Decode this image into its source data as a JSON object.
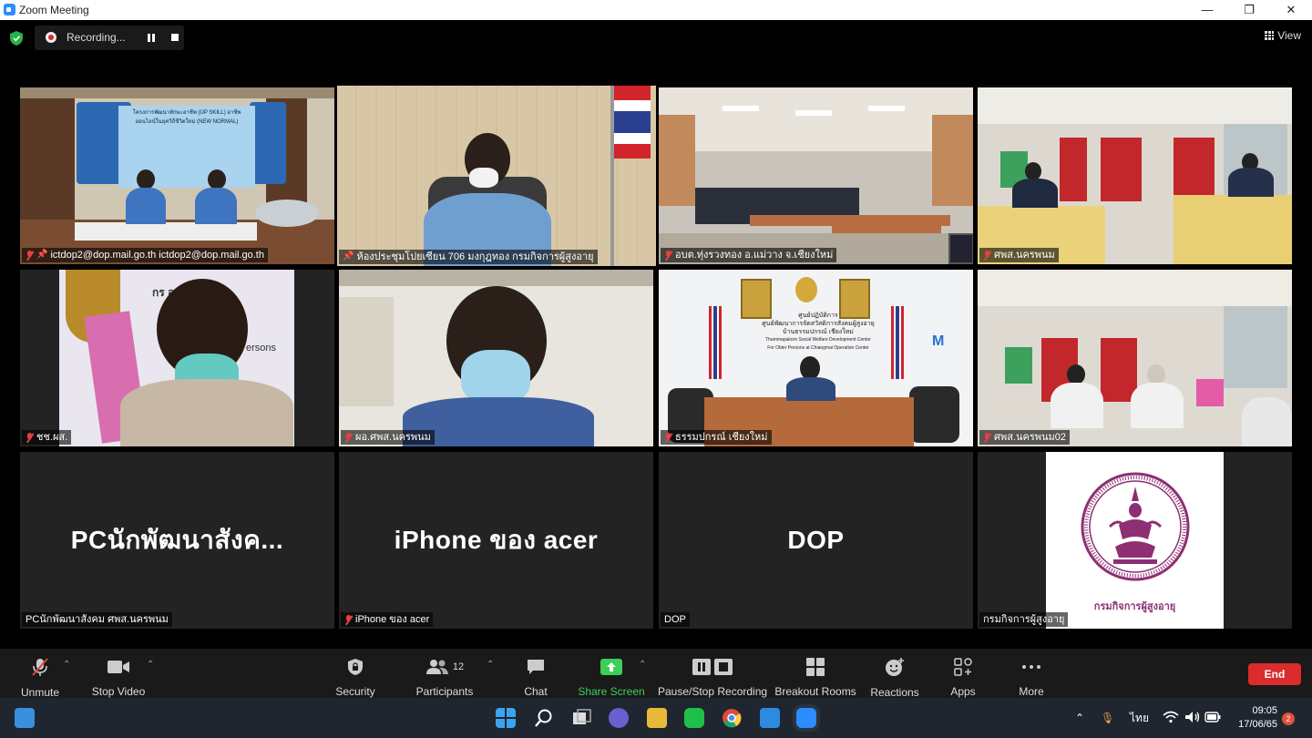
{
  "window": {
    "title": "Zoom Meeting",
    "minimize": "—",
    "maximize": "❐",
    "close": "✕"
  },
  "recording": {
    "label": "Recording..."
  },
  "view": {
    "label": "View"
  },
  "tiles": [
    {
      "name": "ictdop2@dop.mail.go.th ictdop2@dop.mail.go.th",
      "banner": "โครงการพัฒนาทักษะอาชีพ (UP SKILL) อาชีพ",
      "banner2": "ออนไลน์ในยุควิถีชีวิตใหม่ (NEW NORMAL)"
    },
    {
      "name": "ห้องประชุมโปยเซียน 706 มงกุฎทอง กรมกิจการผู้สูงอายุ"
    },
    {
      "name": "อบต.ทุ่งรวงทอง อ.แม่วาง จ.เชียงใหม่"
    },
    {
      "name": "ศพส.นครพนม"
    },
    {
      "name": "ชช.ผส.",
      "banner": "กร        อายุ",
      "banner2": "ersons"
    },
    {
      "name": "ผอ.ศพส.นครพนม"
    },
    {
      "name": "ธรรมปกรณ์ เชียงใหม่",
      "sign1": "ศูนย์ปฏิบัติการ",
      "sign2": "ศูนย์พัฒนาการจัดสวัสดิการสังคมผู้สูงอายุ",
      "sign3": "บ้านธรรมปกรณ์ เชียงใหม่",
      "sign4": "Thammapakorn Social Welfare Development Center",
      "sign5": "For Older Persons at Chiangmai Operation Center"
    },
    {
      "name": "ศพส.นครพนม02"
    },
    {
      "name": "PCนักพัฒนาสังคม ศพส.นครพนม",
      "display": "PCนักพัฒนาสังค..."
    },
    {
      "name": "iPhone ของ acer",
      "display": "iPhone ของ acer"
    },
    {
      "name": "DOP",
      "display": "DOP"
    },
    {
      "name": "กรมกิจการผู้สูงอายุ",
      "logo_text": "กรมกิจการผู้สูงอายุ"
    }
  ],
  "toolbar": {
    "unmute": "Unmute",
    "stop_video": "Stop Video",
    "security": "Security",
    "participants": "Participants",
    "participants_count": "12",
    "chat": "Chat",
    "share_screen": "Share Screen",
    "pause_stop_recording": "Pause/Stop Recording",
    "breakout_rooms": "Breakout Rooms",
    "reactions": "Reactions",
    "apps": "Apps",
    "more": "More",
    "end": "End"
  },
  "taskbar": {
    "language": "ไทย",
    "time": "09:05",
    "date": "17/06/65",
    "notifications": "2"
  }
}
